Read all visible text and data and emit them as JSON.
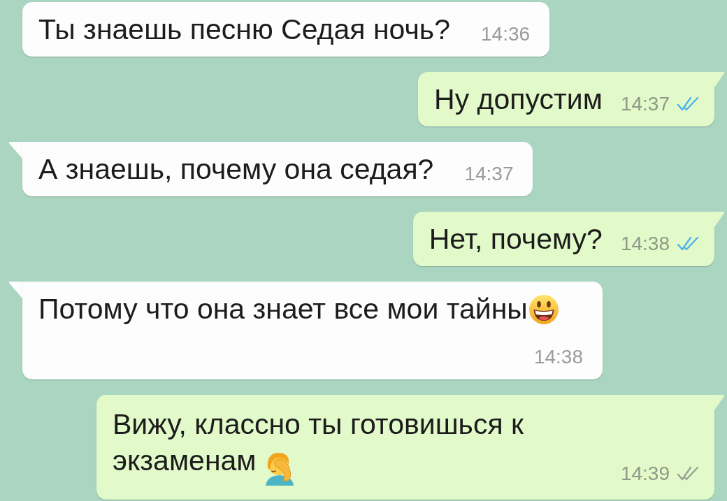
{
  "messages": [
    {
      "outgoing": false,
      "tail": false,
      "text": "Ты знаешь песню Седая ночь?",
      "time": "14:36"
    },
    {
      "outgoing": true,
      "tail": true,
      "text": "Ну допустим",
      "time": "14:37",
      "ticks": {
        "read": true
      }
    },
    {
      "outgoing": false,
      "tail": true,
      "text": "А знаешь, почему она седая?",
      "time": "14:37"
    },
    {
      "outgoing": true,
      "tail": true,
      "text": "Нет, почему?",
      "time": "14:38",
      "ticks": {
        "read": true
      }
    },
    {
      "outgoing": false,
      "tail": true,
      "text": "Потому что она знает все мои тайны",
      "emoji": {
        "kind": "grinning"
      },
      "time": "14:38"
    },
    {
      "outgoing": true,
      "tail": true,
      "text": "Вижу, классно ты готовишься к\nэкзаменам",
      "emoji": {
        "kind": "facepalm"
      },
      "time": "14:39",
      "ticks": {
        "read": false
      }
    }
  ]
}
